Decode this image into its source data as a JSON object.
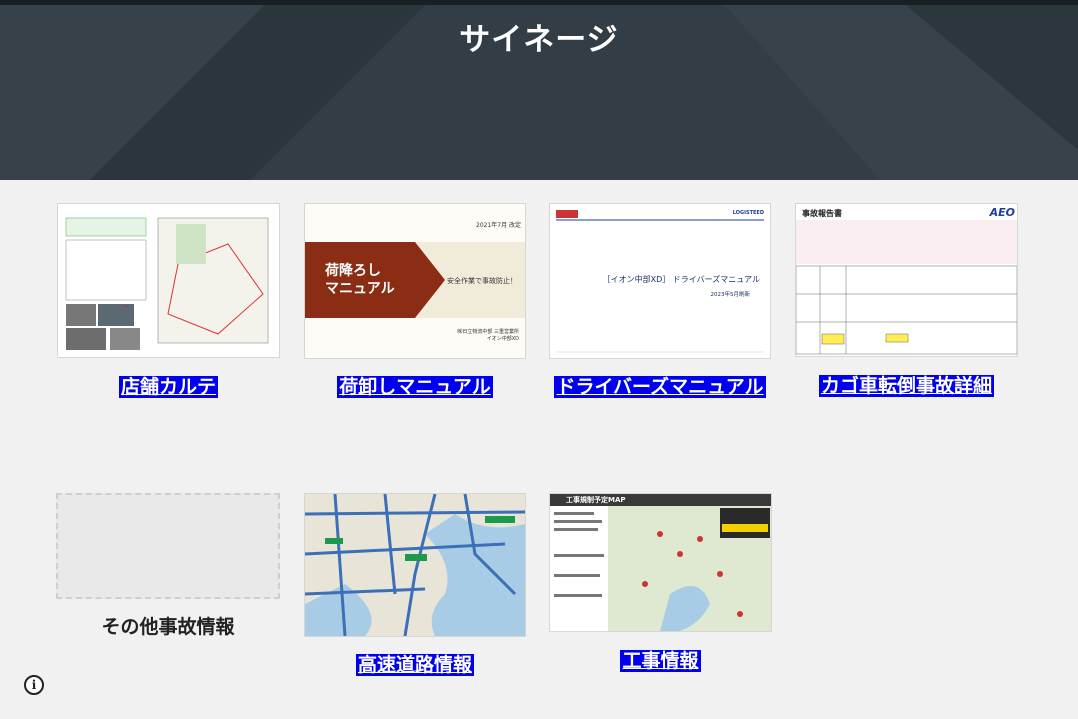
{
  "header": {
    "title": "サイネージ"
  },
  "cards": [
    {
      "caption": "店舗カルテ"
    },
    {
      "caption": "荷卸しマニュアル",
      "thumb": {
        "date": "2021年7月 改定",
        "title_line1": "荷降ろし",
        "title_line2": "マニュアル",
        "slogan": "安全作業で事故防止！",
        "org1": "㈱日立物流中部 三重営業所",
        "org2": "イオン中部XD"
      }
    },
    {
      "caption": "ドライバーズマニュアル",
      "thumb": {
        "brand": "LOGISTEED",
        "title": "［イオン中部XD］ ドライバーズマニュアル",
        "updated": "2023年5月刷新"
      }
    },
    {
      "caption": "カゴ車転倒事故詳細",
      "thumb": {
        "title": "事故報告書",
        "logo": "AEO"
      }
    },
    {
      "caption": "その他事故情報"
    },
    {
      "caption": "高速道路情報"
    },
    {
      "caption": "工事情報",
      "thumb": {
        "title": "工事規制予定MAP"
      }
    }
  ],
  "colors": {
    "link_bg": "#0000ee",
    "header_bg": "#2f3a42"
  },
  "icons": {
    "info": "info-icon"
  }
}
